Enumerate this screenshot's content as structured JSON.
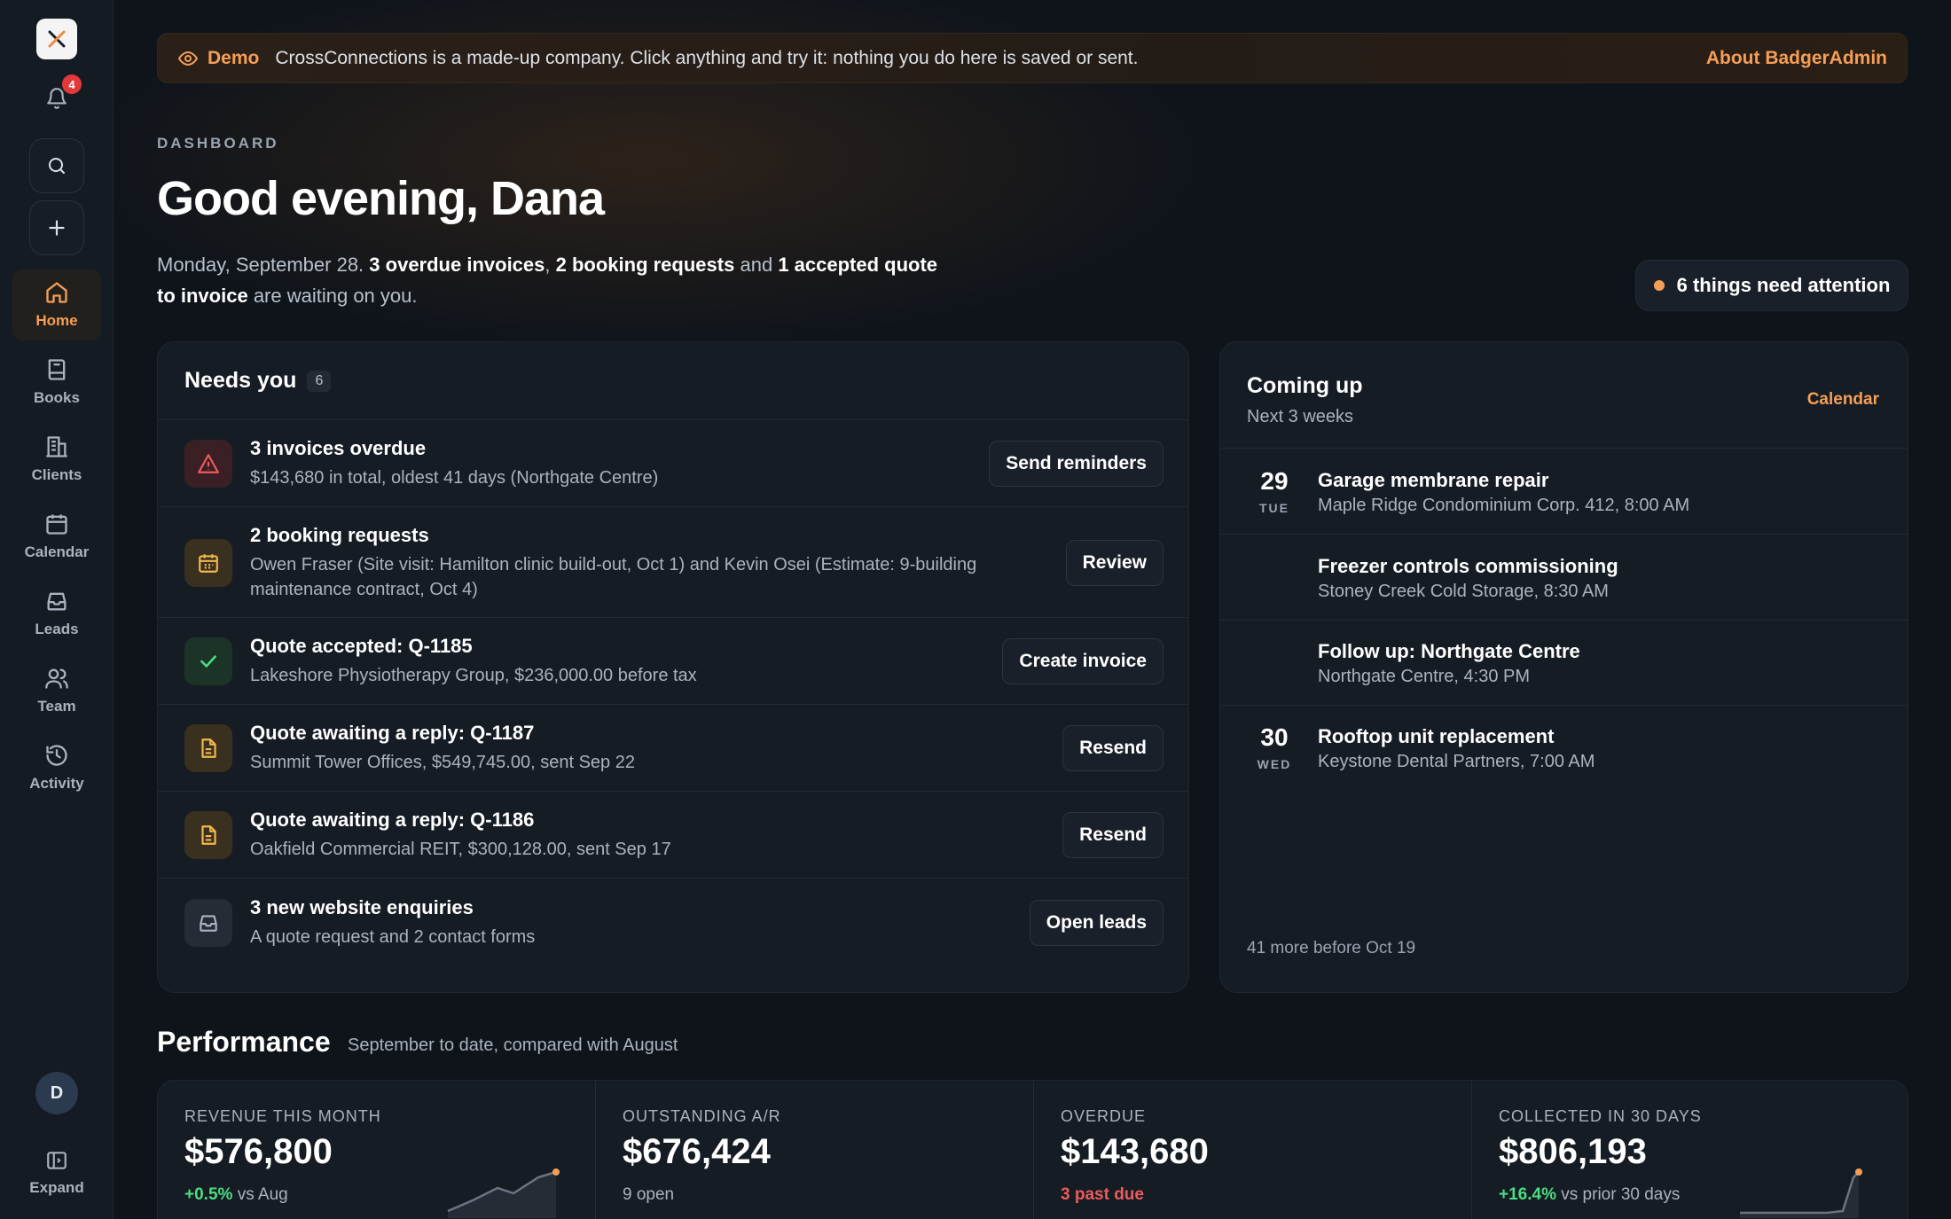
{
  "sidebar": {
    "notification_count": "4",
    "nav": [
      {
        "label": "Home",
        "icon": "home-icon",
        "active": true
      },
      {
        "label": "Books",
        "icon": "book-icon"
      },
      {
        "label": "Clients",
        "icon": "building-icon"
      },
      {
        "label": "Calendar",
        "icon": "calendar-icon"
      },
      {
        "label": "Leads",
        "icon": "inbox-icon"
      },
      {
        "label": "Team",
        "icon": "users-icon"
      },
      {
        "label": "Activity",
        "icon": "history-icon"
      }
    ],
    "avatar_initial": "D",
    "expand_label": "Expand"
  },
  "banner": {
    "tag": "Demo",
    "message": "CrossConnections is a made-up company. Click anything and try it: nothing you do here is saved or sent.",
    "link": "About BadgerAdmin"
  },
  "header": {
    "eyebrow": "DASHBOARD",
    "greeting": "Good evening, Dana",
    "date": "Monday, September 28.",
    "overdue": "3 overdue invoices",
    "bookings": "2 booking requests",
    "connector": "and",
    "accepted": "1 accepted quote to invoice",
    "tail": "are waiting on you.",
    "attention": "6 things need attention"
  },
  "needs": {
    "title": "Needs you",
    "count": "6",
    "items": [
      {
        "title": "3 invoices overdue",
        "sub": "$143,680 in total, oldest 41 days (Northgate Centre)",
        "action": "Send reminders"
      },
      {
        "title": "2 booking requests",
        "sub": "Owen Fraser (Site visit: Hamilton clinic build-out, Oct 1) and Kevin Osei (Estimate: 9-building maintenance contract, Oct 4)",
        "action": "Review"
      },
      {
        "title": "Quote accepted: Q-1185",
        "sub": "Lakeshore Physiotherapy Group, $236,000.00 before tax",
        "action": "Create invoice"
      },
      {
        "title": "Quote awaiting a reply: Q-1187",
        "sub": "Summit Tower Offices, $549,745.00, sent Sep 22",
        "action": "Resend"
      },
      {
        "title": "Quote awaiting a reply: Q-1186",
        "sub": "Oakfield Commercial REIT, $300,128.00, sent Sep 17",
        "action": "Resend"
      },
      {
        "title": "3 new website enquiries",
        "sub": "A quote request and 2 contact forms",
        "action": "Open leads"
      }
    ]
  },
  "coming": {
    "title": "Coming up",
    "sub": "Next 3 weeks",
    "link": "Calendar",
    "events": [
      {
        "day": "29",
        "dow": "TUE",
        "title": "Garage membrane repair",
        "sub": "Maple Ridge Condominium Corp. 412, 8:00 AM"
      },
      {
        "day": "",
        "dow": "",
        "title": "Freezer controls commissioning",
        "sub": "Stoney Creek Cold Storage, 8:30 AM"
      },
      {
        "day": "",
        "dow": "",
        "title": "Follow up: Northgate Centre",
        "sub": "Northgate Centre, 4:30 PM"
      },
      {
        "day": "30",
        "dow": "WED",
        "title": "Rooftop unit replacement",
        "sub": "Keystone Dental Partners, 7:00 AM"
      }
    ],
    "more": "41 more before Oct 19"
  },
  "performance": {
    "title": "Performance",
    "sub": "September to date, compared with August",
    "kpis": [
      {
        "label": "REVENUE THIS MONTH",
        "value": "$576,800",
        "delta": "+0.5%",
        "foot": "vs Aug"
      },
      {
        "label": "OUTSTANDING A/R",
        "value": "$676,424",
        "delta": "",
        "foot": "9 open"
      },
      {
        "label": "OVERDUE",
        "value": "$143,680",
        "delta": "3 past due",
        "foot": ""
      },
      {
        "label": "COLLECTED IN 30 DAYS",
        "value": "$806,193",
        "delta": "+16.4%",
        "foot": "vs prior 30 days"
      }
    ]
  },
  "colors": {
    "accent": "#f59e56",
    "positive": "#4ade80",
    "negative": "#ef5b5b",
    "background": "#0f141b"
  }
}
